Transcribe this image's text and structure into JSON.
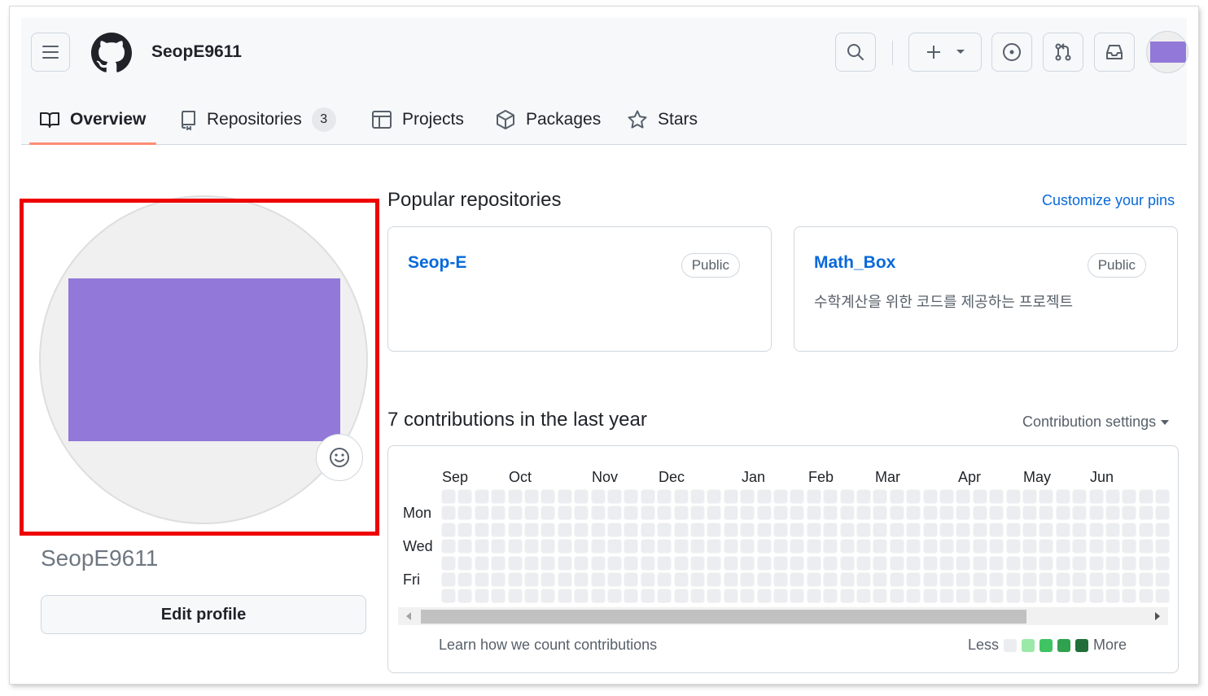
{
  "header": {
    "username": "SeopE9611",
    "colors": {
      "avatar": "#9278d8",
      "tab_underline": "#fd8c73",
      "link": "#0969da"
    },
    "icons": [
      "menu-icon",
      "github-logo-icon",
      "search-icon",
      "plus-icon",
      "chevron-down-icon",
      "issue-icon",
      "pull-request-icon",
      "inbox-icon"
    ]
  },
  "tabs": [
    {
      "label": "Overview",
      "icon": "book-icon",
      "active": true
    },
    {
      "label": "Repositories",
      "icon": "repo-icon",
      "count": "3"
    },
    {
      "label": "Projects",
      "icon": "table-icon"
    },
    {
      "label": "Packages",
      "icon": "package-icon"
    },
    {
      "label": "Stars",
      "icon": "star-icon"
    }
  ],
  "profile": {
    "name": "SeopE9611",
    "edit_label": "Edit profile",
    "emoji_icon": "smiley-icon"
  },
  "popular": {
    "title": "Popular repositories",
    "customize": "Customize your pins",
    "repos": [
      {
        "name": "Seop-E",
        "visibility": "Public",
        "description": ""
      },
      {
        "name": "Math_Box",
        "visibility": "Public",
        "description": "수학계산을 위한 코드를 제공하는 프로젝트"
      }
    ]
  },
  "contributions": {
    "title": "7 contributions in the last year",
    "settings": "Contribution settings",
    "months": [
      "Sep",
      "Oct",
      "Nov",
      "Dec",
      "Jan",
      "Feb",
      "Mar",
      "Apr",
      "May",
      "Jun"
    ],
    "days": [
      "Mon",
      "Wed",
      "Fri"
    ],
    "learn": "Learn how we count contributions",
    "legend_less": "Less",
    "legend_more": "More",
    "legend_colors": [
      "#ebedf0",
      "#9be9a8",
      "#40c463",
      "#30a14e",
      "#216e39"
    ],
    "empty_color": "#ebedf0"
  }
}
